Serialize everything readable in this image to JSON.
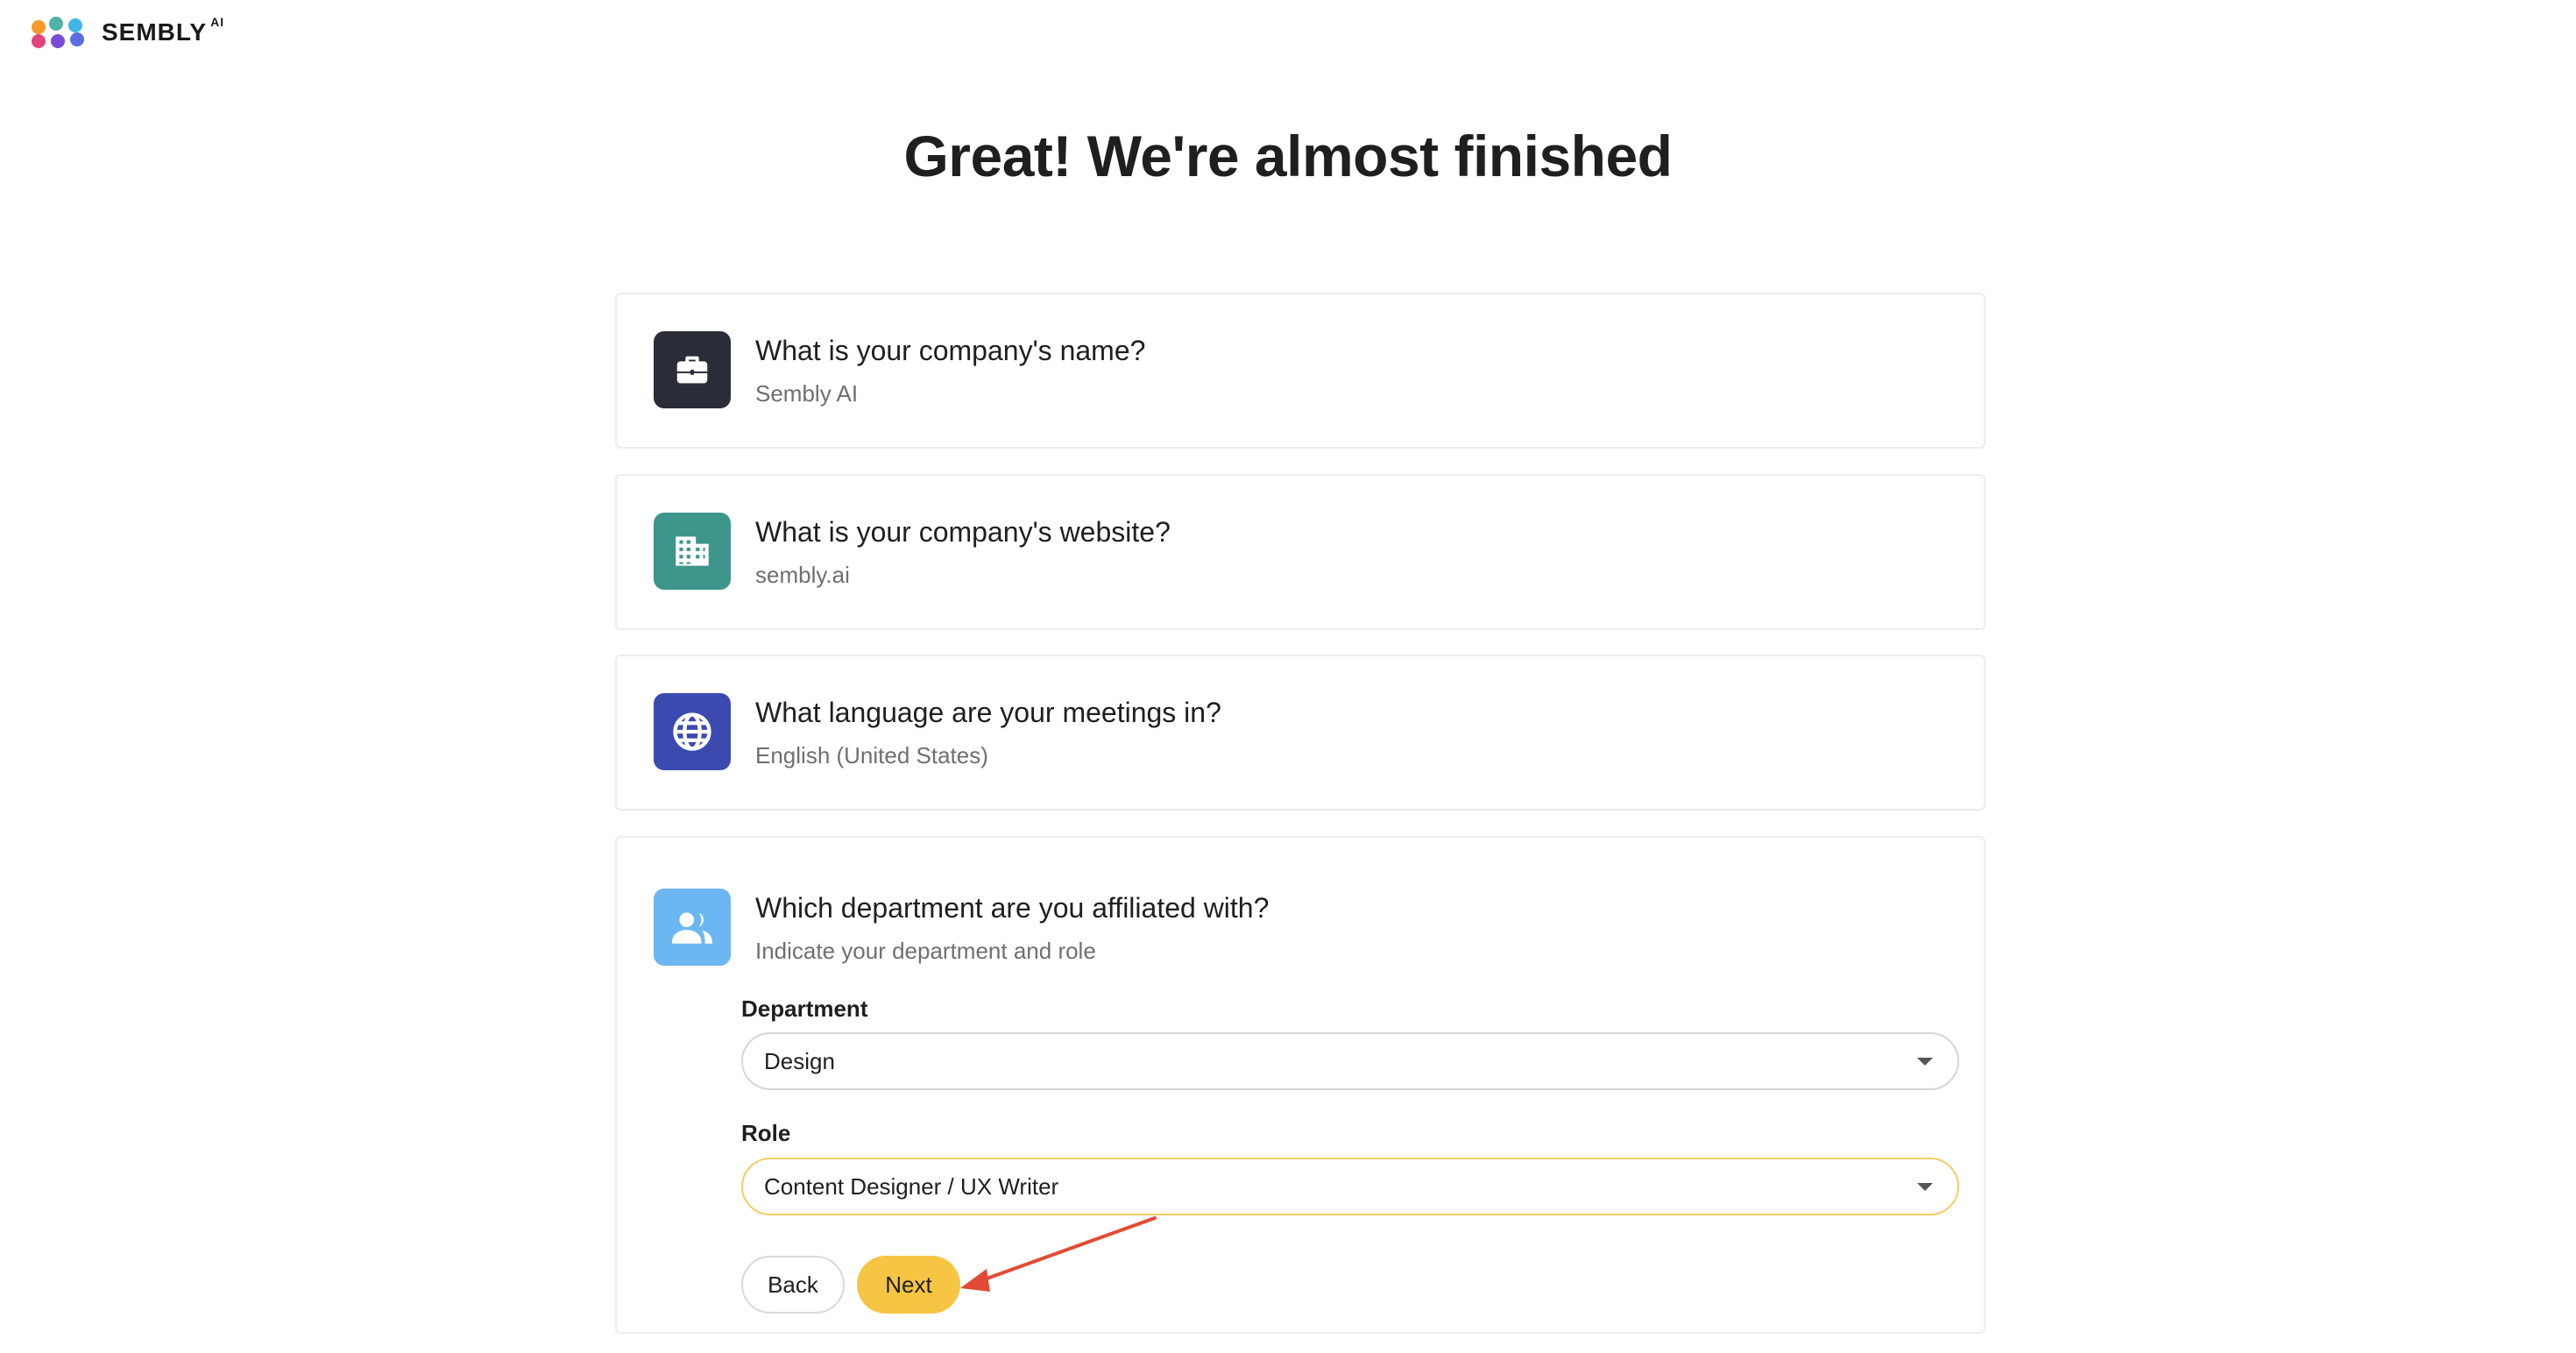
{
  "brand": {
    "name": "SEMBLY",
    "superscript": "AI",
    "dot_colors": [
      "#f59b2b",
      "#4fb3a6",
      "#3fb6e6",
      "#e0457b",
      "#7a4bd6",
      "#5b6de0"
    ]
  },
  "page_title": "Great! We're almost finished",
  "cards": [
    {
      "question": "What is your company's name?",
      "answer": "Sembly AI",
      "icon": "briefcase-icon",
      "icon_color": "#2a2d38"
    },
    {
      "question": "What is your company's website?",
      "answer": "sembly.ai",
      "icon": "building-icon",
      "icon_color": "#3e958c"
    },
    {
      "question": "What language are your meetings in?",
      "answer": "English (United States)",
      "icon": "globe-icon",
      "icon_color": "#3c4ab0"
    },
    {
      "question": "Which department are you affiliated with?",
      "answer": "Indicate your department and role",
      "icon": "people-icon",
      "icon_color": "#6cb6f2"
    }
  ],
  "form": {
    "department_label": "Department",
    "department_value": "Design",
    "role_label": "Role",
    "role_value": "Content Designer / UX Writer"
  },
  "buttons": {
    "back_label": "Back",
    "next_label": "Next",
    "next_color": "#f6c544"
  },
  "annotation": {
    "arrow_color": "#e34a33"
  }
}
